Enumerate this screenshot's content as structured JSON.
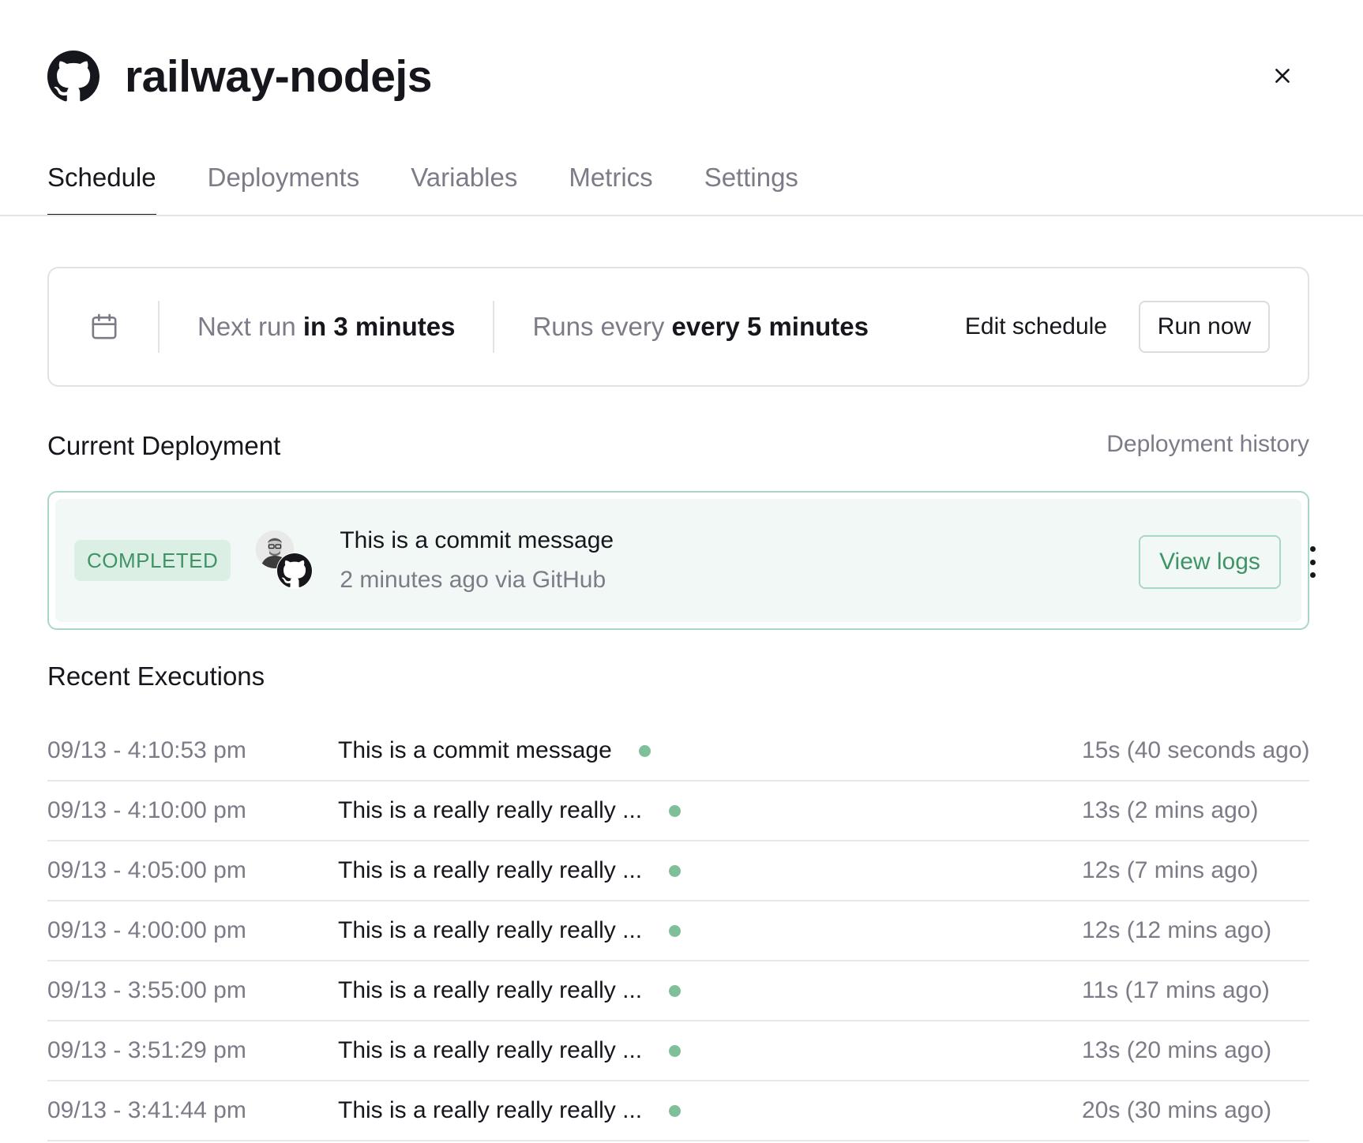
{
  "header": {
    "title": "railway-nodejs",
    "logo_icon": "github-icon",
    "close_icon": "close-icon"
  },
  "tabs": [
    {
      "label": "Schedule",
      "active": true
    },
    {
      "label": "Deployments",
      "active": false
    },
    {
      "label": "Variables",
      "active": false
    },
    {
      "label": "Metrics",
      "active": false
    },
    {
      "label": "Settings",
      "active": false
    }
  ],
  "schedule": {
    "icon": "calendar-icon",
    "next_run_label": "Next run",
    "next_run_value": "in 3 minutes",
    "runs_every_label": "Runs every",
    "runs_every_value": "every 5 minutes",
    "edit_label": "Edit schedule",
    "run_now_label": "Run now"
  },
  "current_deployment": {
    "section_title": "Current Deployment",
    "history_link": "Deployment history",
    "status": "COMPLETED",
    "commit_message": "This is a commit message",
    "meta": "2 minutes ago via GitHub",
    "view_logs_label": "View logs",
    "menu_icon": "more-vertical-icon"
  },
  "recent_executions": {
    "section_title": "Recent Executions",
    "rows": [
      {
        "timestamp": "09/13 - 4:10:53 pm",
        "message": "This is a commit message",
        "duration": "15s (40 seconds ago)"
      },
      {
        "timestamp": "09/13 - 4:10:00 pm",
        "message": "This is a really really really ...",
        "duration": "13s (2 mins ago)"
      },
      {
        "timestamp": "09/13 - 4:05:00 pm",
        "message": "This is a really really really ...",
        "duration": "12s (7 mins ago)"
      },
      {
        "timestamp": "09/13 - 4:00:00 pm",
        "message": "This is a really really really ...",
        "duration": "12s (12 mins ago)"
      },
      {
        "timestamp": "09/13 - 3:55:00 pm",
        "message": "This is a really really really ...",
        "duration": "11s (17 mins ago)"
      },
      {
        "timestamp": "09/13 - 3:51:29 pm",
        "message": "This is a really really really ...",
        "duration": "13s (20 mins ago)"
      },
      {
        "timestamp": "09/13 - 3:41:44 pm",
        "message": "This is a really really really ...",
        "duration": "20s (30 mins ago)"
      }
    ]
  },
  "colors": {
    "success": "#3f9466",
    "success_dot": "#7fbf9a",
    "success_border": "#a8d8c4",
    "card_bg": "#f2f8f6"
  }
}
